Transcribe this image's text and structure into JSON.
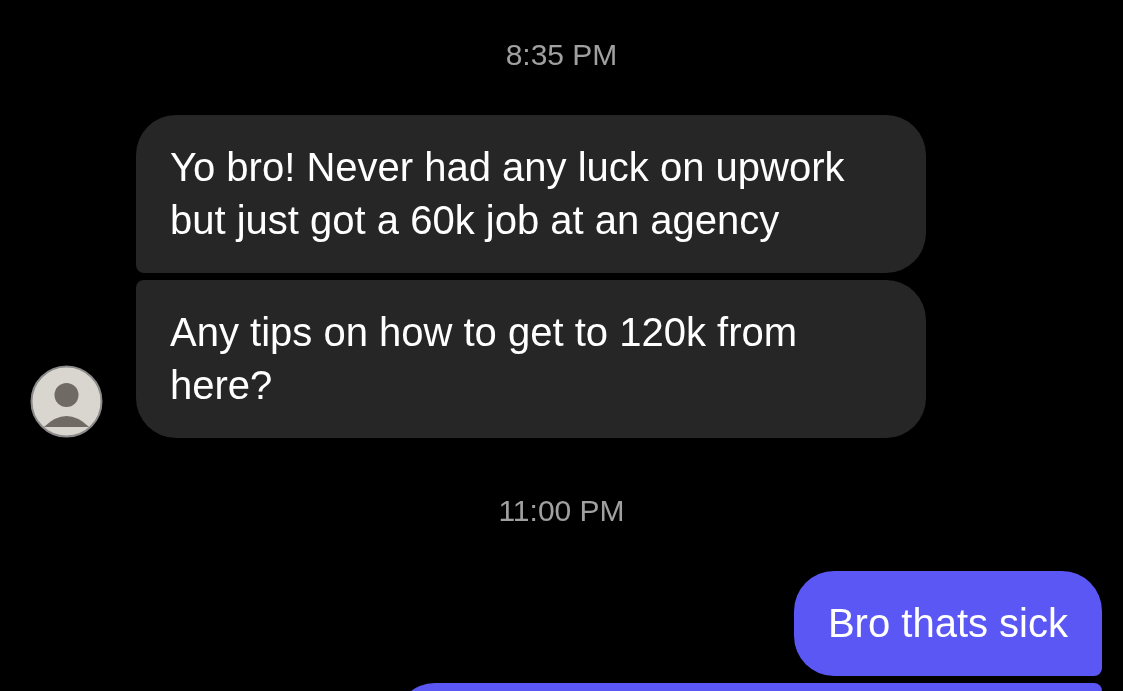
{
  "conversation": [
    {
      "kind": "timestamp",
      "text": "8:35 PM"
    },
    {
      "kind": "incoming",
      "text": "Yo bro! Never had any luck on upwork but just got a 60k job at an agency",
      "avatar": false
    },
    {
      "kind": "incoming",
      "text": "Any tips on how to get to 120k from here?",
      "avatar": true
    },
    {
      "kind": "timestamp",
      "text": "11:00 PM"
    },
    {
      "kind": "outgoing",
      "text": "Bro thats sick"
    },
    {
      "kind": "outgoing"
    }
  ]
}
